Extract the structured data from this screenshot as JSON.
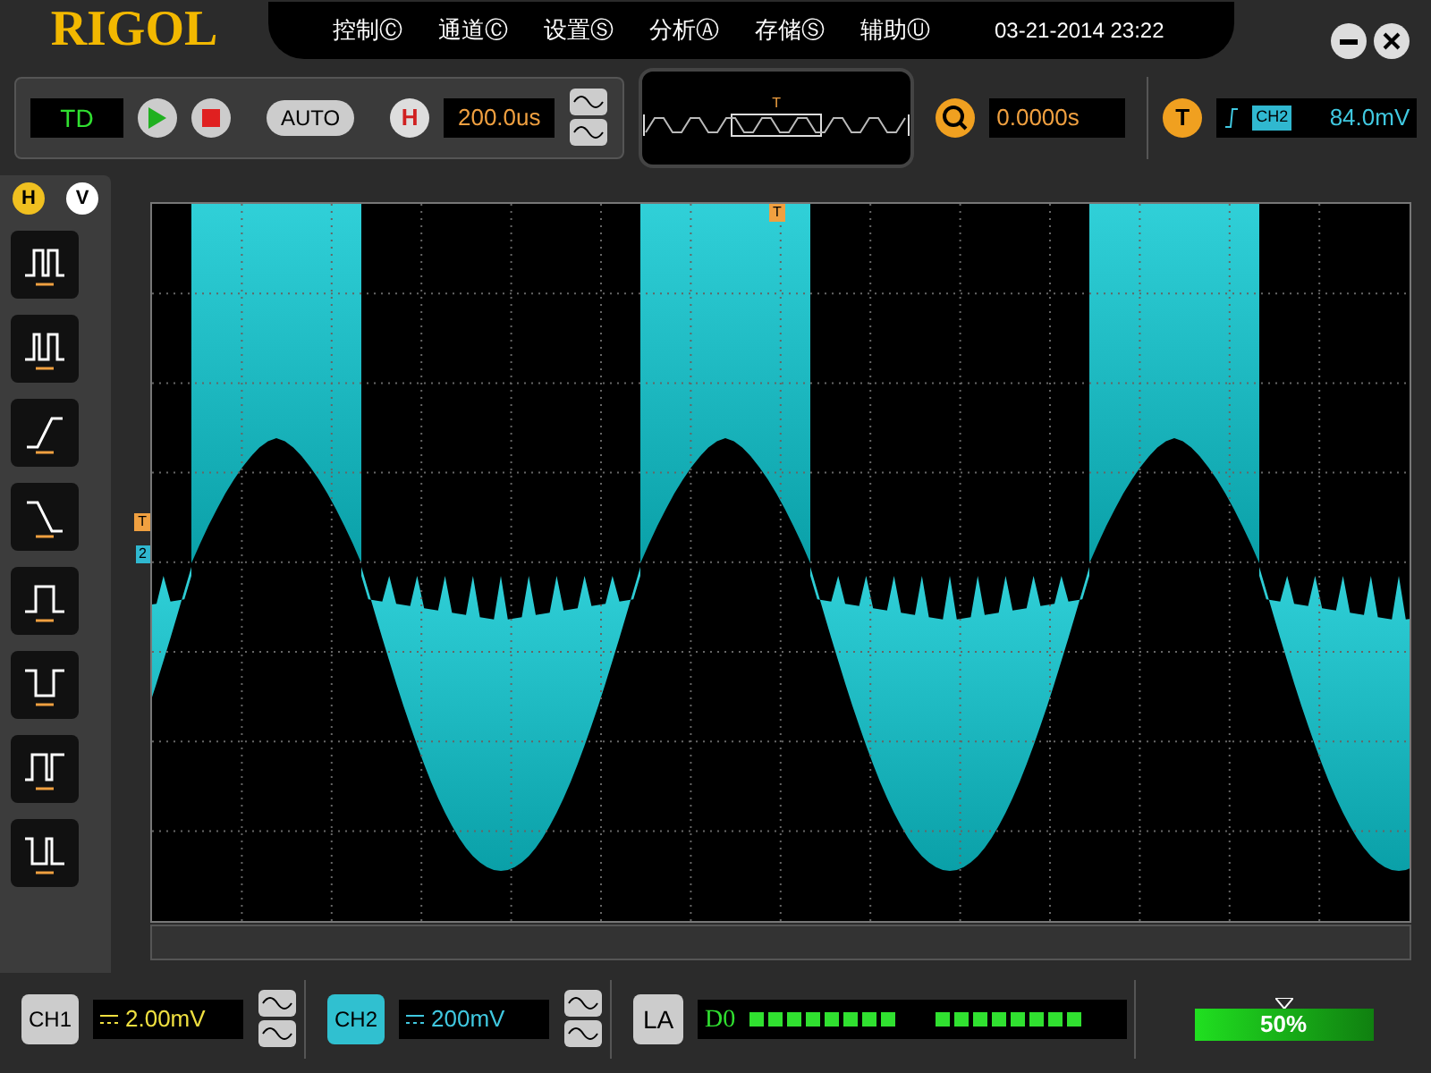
{
  "logo": "RIGOL",
  "menu": [
    {
      "label": "控制Ⓒ"
    },
    {
      "label": "通道Ⓒ"
    },
    {
      "label": "设置Ⓢ"
    },
    {
      "label": "分析Ⓐ"
    },
    {
      "label": "存储Ⓢ"
    },
    {
      "label": "辅助Ⓤ"
    }
  ],
  "datetime": "03-21-2014 23:22",
  "toolbar": {
    "mode": "TD",
    "auto": "AUTO",
    "h_badge": "H",
    "timebase": "200.0us",
    "nav_marker": "T",
    "zoom_offset": "0.0000s",
    "t_badge": "T",
    "trigger_source": "CH2",
    "trigger_level": "84.0mV"
  },
  "side_tabs": [
    {
      "label": "H",
      "selected": true
    },
    {
      "label": "V",
      "selected": false
    }
  ],
  "measure_buttons": [
    {
      "kind": "period"
    },
    {
      "kind": "frequency"
    },
    {
      "kind": "rise"
    },
    {
      "kind": "fall"
    },
    {
      "kind": "pos_width"
    },
    {
      "kind": "neg_width"
    },
    {
      "kind": "pos_duty"
    },
    {
      "kind": "neg_duty"
    }
  ],
  "plot": {
    "top_marker": "T",
    "trigger_marker": "T",
    "channel_marker": "2"
  },
  "channels": [
    {
      "label": "CH1",
      "selected": false,
      "scale": "2.00mV"
    },
    {
      "label": "CH2",
      "selected": true,
      "scale": "200mV"
    }
  ],
  "la": {
    "label": "LA",
    "channel": "D0"
  },
  "memory": {
    "reading": "50%"
  }
}
